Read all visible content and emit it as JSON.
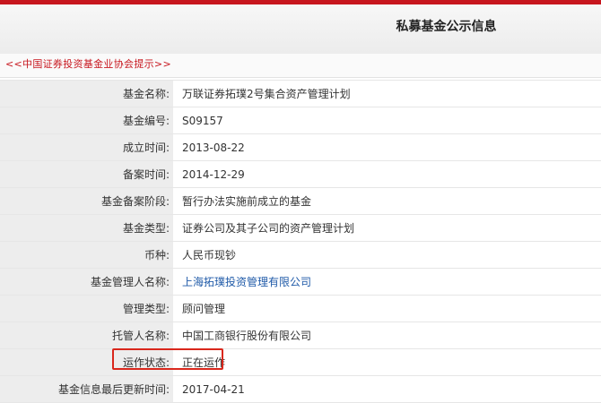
{
  "page": {
    "title": "私募基金公示信息",
    "notice": "<<中国证券投资基金业协会提示>>"
  },
  "rows": [
    {
      "label": "基金名称:",
      "value": "万联证券拓璞2号集合资产管理计划"
    },
    {
      "label": "基金编号:",
      "value": "S09157"
    },
    {
      "label": "成立时间:",
      "value": "2013-08-22"
    },
    {
      "label": "备案时间:",
      "value": "2014-12-29"
    },
    {
      "label": "基金备案阶段:",
      "value": "暂行办法实施前成立的基金"
    },
    {
      "label": "基金类型:",
      "value": "证券公司及其子公司的资产管理计划"
    },
    {
      "label": "币种:",
      "value": "人民币现钞"
    },
    {
      "label": "基金管理人名称:",
      "value": "上海拓璞投资管理有限公司"
    },
    {
      "label": "管理类型:",
      "value": "顾问管理"
    },
    {
      "label": "托管人名称:",
      "value": "中国工商银行股份有限公司"
    },
    {
      "label": "运作状态:",
      "value": "正在运作"
    },
    {
      "label": "基金信息最后更新时间:",
      "value": "2017-04-21"
    }
  ],
  "colors": {
    "accent_red": "#c7161e",
    "highlight_box": "#d9271c",
    "link_blue": "#1f5aa8",
    "label_bg": "#ededed"
  }
}
